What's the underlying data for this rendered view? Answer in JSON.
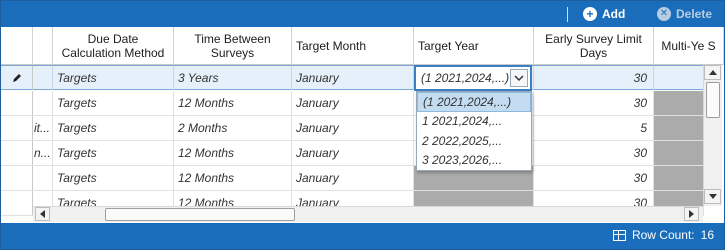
{
  "toolbar": {
    "add_label": "Add",
    "add_icon": "plus-circle-icon",
    "delete_label": "Delete",
    "delete_icon": "x-circle-icon"
  },
  "grid": {
    "columns": [
      {
        "label": ""
      },
      {
        "label": "Due Date Calculation Method"
      },
      {
        "label": "Time Between Surveys"
      },
      {
        "label": "Target Month"
      },
      {
        "label": "Target Year"
      },
      {
        "label": "Early Survey Limit Days"
      },
      {
        "label": "Multi-Ye S"
      }
    ],
    "rows": [
      {
        "prefix": "",
        "method": "Targets",
        "time": "3 Years",
        "month": "January",
        "year": "(1   2021,2024,...)",
        "early": "30"
      },
      {
        "prefix": "",
        "method": "Targets",
        "time": "12 Months",
        "month": "January",
        "year": "",
        "early": "30"
      },
      {
        "prefix": "it...",
        "method": "Targets",
        "time": "2 Months",
        "month": "January",
        "year": "",
        "early": "5"
      },
      {
        "prefix": "n...",
        "method": "Targets",
        "time": "12 Months",
        "month": "January",
        "year": "",
        "early": "30"
      },
      {
        "prefix": "",
        "method": "Targets",
        "time": "12 Months",
        "month": "January",
        "year": "",
        "early": "30"
      },
      {
        "prefix": "",
        "method": "Targets",
        "time": "12 Months",
        "month": "January",
        "year": "",
        "early": "30"
      }
    ],
    "editing_row_icon": "pencil-icon"
  },
  "target_year_dropdown": {
    "options": [
      "(1   2021,2024,...)",
      "1   2021,2024,...",
      "2   2022,2025,...",
      "3   2023,2026,..."
    ],
    "highlighted_index": 0
  },
  "status": {
    "row_count_label": "Row Count:",
    "row_count": "16"
  },
  "colors": {
    "toolbar_bg": "#1a6dba",
    "selected_row_bg": "#e6f0fa",
    "disabled_cell": "#ababab",
    "dropdown_highlight": "#c3dcf2"
  }
}
